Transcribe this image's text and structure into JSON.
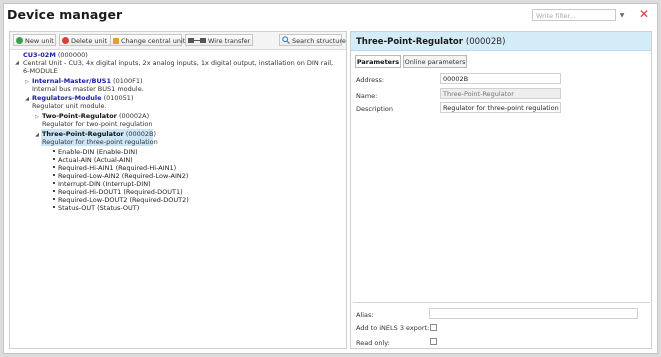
{
  "window": {
    "title": "Device manager",
    "filter_placeholder": "Write filter...",
    "filter_arrow": "▼",
    "close_glyph": "✕"
  },
  "toolbar": {
    "new_unit": "New unit",
    "delete_unit": "Delete unit",
    "change_central_unit": "Change central unit",
    "wire_transfer": "Wire transfer",
    "search_structure": "Search structure",
    "icons": {
      "new_unit": "plus-circle-icon",
      "delete_unit": "minus-circle-icon",
      "change_central_unit": "pencil-icon",
      "wire_transfer": "wire-transfer-icon",
      "search_structure": "magnifier-icon"
    },
    "colors": {
      "new_unit": "#3aa14a",
      "delete_unit": "#d9403a",
      "change_central_unit": "#e6a02a",
      "search_structure": "#3b7fc4"
    }
  },
  "tree": {
    "root": {
      "name": "CU3-02M",
      "code": "(000000)"
    },
    "central": {
      "desc_line1": "Central Unit - CU3, 4x digital inputs, 2x analog inputs, 1x digital output, installation on DIN rail,",
      "desc_line2": "6-MODULE"
    },
    "master": {
      "name": "Internal-Master/BUS1",
      "code": "(0100F1)",
      "desc": "Internal bus master BUS1 module."
    },
    "regulators": {
      "name": "Regulators-Module",
      "code": "(010051)",
      "desc": "Regulator unit module."
    },
    "two_point": {
      "name": "Two-Point-Regulator",
      "code": "(00002A)",
      "desc": "Regulator for two-point regulation"
    },
    "three_point": {
      "name": "Three-Point-Regulator",
      "code": "(00002B)",
      "desc": "Regulator for three-point regulation"
    },
    "channels": [
      "Enable-DIN (Enable-DIN)",
      "Actual-AIN (Actual-AIN)",
      "Required-Hi-AIN1 (Required-Hi-AIN1)",
      "Required-Low-AIN2 (Required-Low-AIN2)",
      "Interrupt-DIN (Interrupt-DIN)",
      "Required-Hi-DOUT1 (Required-DOUT1)",
      "Required-Low-DOUT2 (Required-DOUT2)",
      "Status-OUT (Status-OUT)"
    ],
    "expand_glyph": "▷",
    "collapse_glyph": "◢",
    "link_color": "#1a1aa8",
    "selection_color": "#cde6f7"
  },
  "details": {
    "title": "Three-Point-Regulator",
    "code": "(00002B)",
    "header_color": "#d3ecf8",
    "tabs": [
      "Parameters",
      "Online parameters"
    ],
    "address_label": "Address:",
    "address_value": "00002B",
    "name_label": "Name:",
    "name_value": "Three-Point-Regulator",
    "description_label": "Description",
    "description_value": "Regulator for three-point regulation",
    "alias_label": "Alias:",
    "alias_value": "",
    "inels_label": "Add to iNELS 3 export:",
    "inels_checked": false,
    "readonly_label": "Read only:",
    "readonly_checked": false
  }
}
